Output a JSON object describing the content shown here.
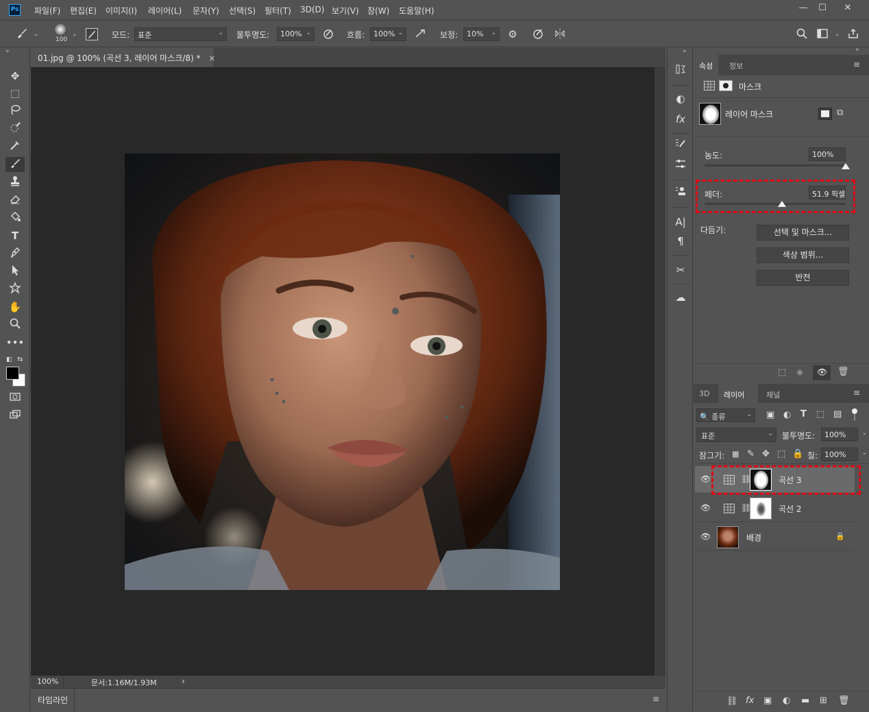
{
  "menubar": {
    "logo": "Ps",
    "items": [
      "파일(F)",
      "편집(E)",
      "이미지(I)",
      "레이어(L)",
      "문자(Y)",
      "선택(S)",
      "필터(T)",
      "3D(D)",
      "보기(V)",
      "창(W)",
      "도움말(H)"
    ],
    "window_controls": {
      "minimize": "—",
      "maximize": "☐",
      "close": "✕"
    }
  },
  "options_bar": {
    "brush_size": "100",
    "mode_label": "모드:",
    "mode_value": "표준",
    "opacity_label": "불투명도:",
    "opacity_value": "100%",
    "flow_label": "흐름:",
    "flow_value": "100%",
    "smoothing_label": "보정:",
    "smoothing_value": "10%"
  },
  "document": {
    "tab_title": "01.jpg @ 100% (곡선 3, 레이어 마스크/8) *",
    "tab_close": "×",
    "status_zoom": "100%",
    "status_doc": "문서:1.16M/1.93M",
    "status_arrow": "›"
  },
  "timeline": {
    "label": "타임라인",
    "menu": "≡"
  },
  "properties": {
    "tabs": [
      "속성",
      "정보"
    ],
    "active_tab": "속성",
    "type_label": "마스크",
    "mask_title": "레이어 마스크",
    "density_label": "농도:",
    "density_value": "100%",
    "density_fraction": 1.0,
    "feather_label": "페더:",
    "feather_value": "51.9 픽셀",
    "feather_fraction": 0.55,
    "refine_label": "다듬기:",
    "buttons": [
      "선택 및 마스크...",
      "색상 범위...",
      "반전"
    ]
  },
  "layers_panel": {
    "tabs": [
      "3D",
      "레이어",
      "채널"
    ],
    "active_tab": "레이어",
    "filter_kind": "종류",
    "blend_mode": "표준",
    "opacity_label": "불투명도:",
    "opacity_value": "100%",
    "lock_label": "잠그기:",
    "fill_label": "칠:",
    "fill_value": "100%",
    "layers": [
      {
        "name": "곡선 3",
        "selected": true
      },
      {
        "name": "곡선 2",
        "selected": false
      },
      {
        "name": "배경",
        "selected": false,
        "locked": true
      }
    ]
  },
  "colors": {
    "highlight_box": "#e30613",
    "ps_blue": "#31a8ff",
    "foreground": "#000000",
    "background": "#ffffff"
  }
}
